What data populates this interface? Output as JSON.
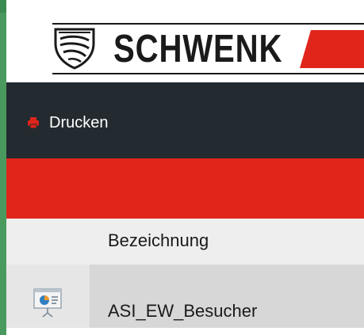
{
  "header": {
    "logo_text": "SCHWENK",
    "brand_red": "#e0251b",
    "shield_icon": "shield-logo-icon"
  },
  "toolbar": {
    "print_label": "Drucken",
    "print_icon": "printer-icon",
    "background": "#232b30"
  },
  "table": {
    "columns": [
      "Bezeichnung"
    ],
    "rows": [
      {
        "icon": "presentation-icon",
        "name": "ASI_EW_Besucher"
      }
    ]
  },
  "colors": {
    "accent_green": "#4a9a5f",
    "header_row": "#eeeeee",
    "selected_row": "#d7d7d7"
  }
}
